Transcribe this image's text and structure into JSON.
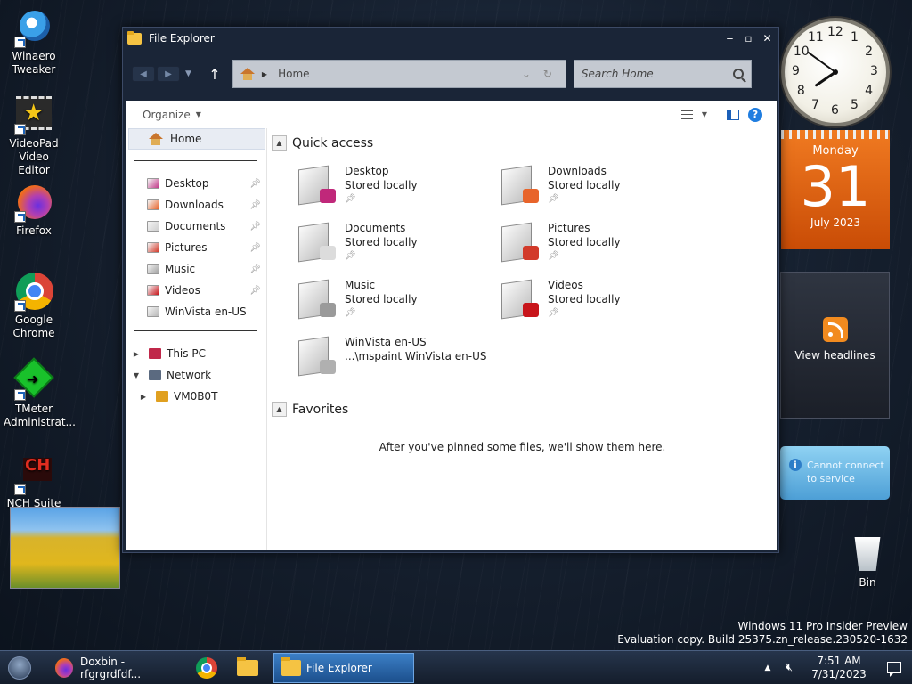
{
  "desktop": {
    "icons": [
      {
        "label": "Winaero Tweaker",
        "icon": "winaero-icon"
      },
      {
        "label": "VideoPad Video Editor",
        "icon": "videopad-icon"
      },
      {
        "label": "Firefox",
        "icon": "firefox-icon"
      },
      {
        "label": "Google Chrome",
        "icon": "chrome-icon"
      },
      {
        "label": "TMeter Administrat...",
        "icon": "tmeter-icon"
      },
      {
        "label": "NCH Suite",
        "icon": "nch-icon"
      }
    ],
    "bin_label": "Bin",
    "watermark": {
      "line1": "Windows 11 Pro Insider Preview",
      "line2": "Evaluation copy. Build 25375.zn_release.230520-1632"
    }
  },
  "gadgets": {
    "clock": {
      "numbers": [
        "12",
        "1",
        "2",
        "3",
        "4",
        "5",
        "6",
        "7",
        "8",
        "9",
        "10",
        "11"
      ],
      "hour": 7,
      "minute": 51
    },
    "calendar": {
      "weekday": "Monday",
      "day": "31",
      "month_year": "July 2023"
    },
    "feed": {
      "label": "View headlines"
    },
    "weather": {
      "message": "Cannot connect to service"
    }
  },
  "window": {
    "title": "File Explorer",
    "controls": {
      "minimize": "‒",
      "maximize": "▫",
      "close": "✕"
    },
    "address": {
      "location": "Home",
      "separator": "▶"
    },
    "search": {
      "placeholder": "Search Home"
    },
    "toolbar": {
      "organize": "Organize"
    },
    "nav": {
      "home": "Home",
      "pinned": [
        "Desktop",
        "Downloads",
        "Documents",
        "Pictures",
        "Music",
        "Videos"
      ],
      "unpinned": [
        "WinVista en-US"
      ],
      "tree": [
        {
          "label": "This PC",
          "expander": "▶"
        },
        {
          "label": "Network",
          "expander": "▼"
        },
        {
          "label": "VM0B0T",
          "expander": "▶"
        }
      ]
    },
    "quick_access": {
      "heading": "Quick access",
      "items": [
        {
          "name": "Desktop",
          "detail": "Stored locally",
          "pinned": true,
          "icon": "desktop-folder-icon",
          "badge": "#c0287a"
        },
        {
          "name": "Downloads",
          "detail": "Stored locally",
          "pinned": true,
          "icon": "downloads-folder-icon",
          "badge": "#e8642a"
        },
        {
          "name": "Documents",
          "detail": "Stored locally",
          "pinned": true,
          "icon": "documents-folder-icon",
          "badge": "#dcdcdc"
        },
        {
          "name": "Pictures",
          "detail": "Stored locally",
          "pinned": true,
          "icon": "pictures-folder-icon",
          "badge": "#d23a2a"
        },
        {
          "name": "Music",
          "detail": "Stored locally",
          "pinned": true,
          "icon": "music-folder-icon",
          "badge": "#9a9a9a"
        },
        {
          "name": "Videos",
          "detail": "Stored locally",
          "pinned": true,
          "icon": "videos-folder-icon",
          "badge": "#c8151b"
        },
        {
          "name": "WinVista en-US",
          "detail": "...\\mspaint WinVista en-US",
          "pinned": false,
          "icon": "winvista-folder-icon",
          "badge": "#b0b0b0"
        }
      ]
    },
    "favorites": {
      "heading": "Favorites",
      "empty_message": "After you've pinned some files, we'll show them here."
    }
  },
  "taskbar": {
    "firefox_label": "Doxbin - rfgrgrdfdf...",
    "explorer_label": "File Explorer",
    "time": "7:51 AM",
    "date": "7/31/2023"
  },
  "colors": {
    "accent": "#1f7de0",
    "calendar": "#e8660f",
    "window_frame": "#1a2537"
  }
}
